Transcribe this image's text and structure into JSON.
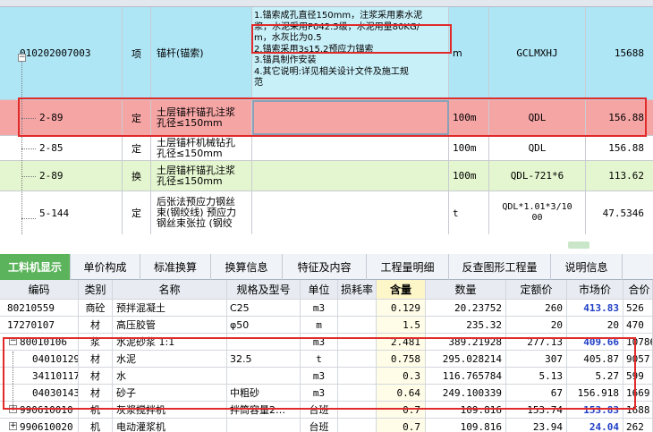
{
  "upper": {
    "rows": [
      {
        "code": "010202007003",
        "type": "项",
        "name": "锚杆(锚索)",
        "feature": "1.锚索成孔直径150mm，注浆采用素水泥\n浆，水泥采用P042.5级，水泥用量80KG/\nm，水灰比为0.5\n2.锚索采用3s15.2预应力锚索\n3.锚具制作安装\n4.其它说明:详见相关设计文件及施工规\n范",
        "unit": "m",
        "expr": "GCLMXHJ",
        "qty": "15688"
      },
      {
        "code": "2-89",
        "type": "定",
        "name": "土层锚杆锚孔注浆\n孔径≤150mm",
        "feature": "",
        "unit": "100m",
        "expr": "QDL",
        "qty": "156.88"
      },
      {
        "code": "2-85",
        "type": "定",
        "name": "土层锚杆机械钻孔\n孔径≤150mm",
        "feature": "",
        "unit": "100m",
        "expr": "QDL",
        "qty": "156.88"
      },
      {
        "code": "2-89",
        "type": "换",
        "name": "土层锚杆锚孔注浆\n孔径≤150mm",
        "feature": "",
        "unit": "100m",
        "expr": "QDL-721*6",
        "qty": "113.62"
      },
      {
        "code": "5-144",
        "type": "定",
        "name": "后张法预应力钢丝\n束(钢绞线) 预应力\n钢丝束张拉 (钢绞",
        "feature": "",
        "unit": "t",
        "expr": "QDL*1.01*3/10\n00",
        "qty": "47.5346"
      }
    ],
    "expand_symbol": "−"
  },
  "tabs": [
    "工料机显示",
    "单价构成",
    "标准换算",
    "换算信息",
    "特征及内容",
    "工程量明细",
    "反查图形工程量",
    "说明信息"
  ],
  "lower": {
    "headers": {
      "code": "编码",
      "type": "类别",
      "name": "名称",
      "spec": "规格及型号",
      "unit": "单位",
      "loss": "损耗率",
      "content": "含量",
      "qty": "数量",
      "quota": "定额价",
      "market": "市场价",
      "combined": "合价"
    },
    "rows": [
      {
        "code": "80210559",
        "type": "商砼",
        "name": "预拌混凝土",
        "spec": "C25",
        "unit": "m3",
        "loss": "",
        "content": "0.129",
        "qty": "20.23752",
        "quota": "260",
        "market": "413.83",
        "combined": "526",
        "mblue": true,
        "exp": ""
      },
      {
        "code": "17270107",
        "type": "材",
        "name": "高压胶管",
        "spec": "φ50",
        "unit": "m",
        "loss": "",
        "content": "1.5",
        "qty": "235.32",
        "quota": "20",
        "market": "20",
        "combined": "470",
        "mblue": false,
        "exp": ""
      },
      {
        "code": "80010106",
        "type": "浆",
        "name": "水泥砂浆 1:1",
        "spec": "",
        "unit": "m3",
        "loss": "",
        "content": "2.481",
        "qty": "389.21928",
        "quota": "277.13",
        "market": "409.66",
        "combined": "10786",
        "mblue": true,
        "exp": "−"
      },
      {
        "code": "04010129",
        "type": "材",
        "name": "水泥",
        "spec": "32.5",
        "unit": "t",
        "loss": "",
        "content": "0.758",
        "qty": "295.028214",
        "quota": "307",
        "market": "405.87",
        "combined": "9057",
        "mblue": false,
        "exp": ""
      },
      {
        "code": "34110117",
        "type": "材",
        "name": "水",
        "spec": "",
        "unit": "m3",
        "loss": "",
        "content": "0.3",
        "qty": "116.765784",
        "quota": "5.13",
        "market": "5.27",
        "combined": "599",
        "mblue": false,
        "exp": ""
      },
      {
        "code": "04030143",
        "type": "材",
        "name": "砂子",
        "spec": "中粗砂",
        "unit": "m3",
        "loss": "",
        "content": "0.64",
        "qty": "249.100339",
        "quota": "67",
        "market": "156.918",
        "combined": "1669",
        "mblue": false,
        "exp": ""
      },
      {
        "code": "990610010",
        "type": "机",
        "name": "灰浆搅拌机",
        "spec": "拌筒容量2…",
        "unit": "台班",
        "loss": "",
        "content": "0.7",
        "qty": "109.816",
        "quota": "153.74",
        "market": "153.83",
        "combined": "1688",
        "mblue": true,
        "exp": "+"
      },
      {
        "code": "990610020",
        "type": "机",
        "name": "电动灌浆机",
        "spec": "",
        "unit": "台班",
        "loss": "",
        "content": "0.7",
        "qty": "109.816",
        "quota": "23.94",
        "market": "24.04",
        "combined": "262",
        "mblue": true,
        "exp": "+"
      }
    ]
  }
}
